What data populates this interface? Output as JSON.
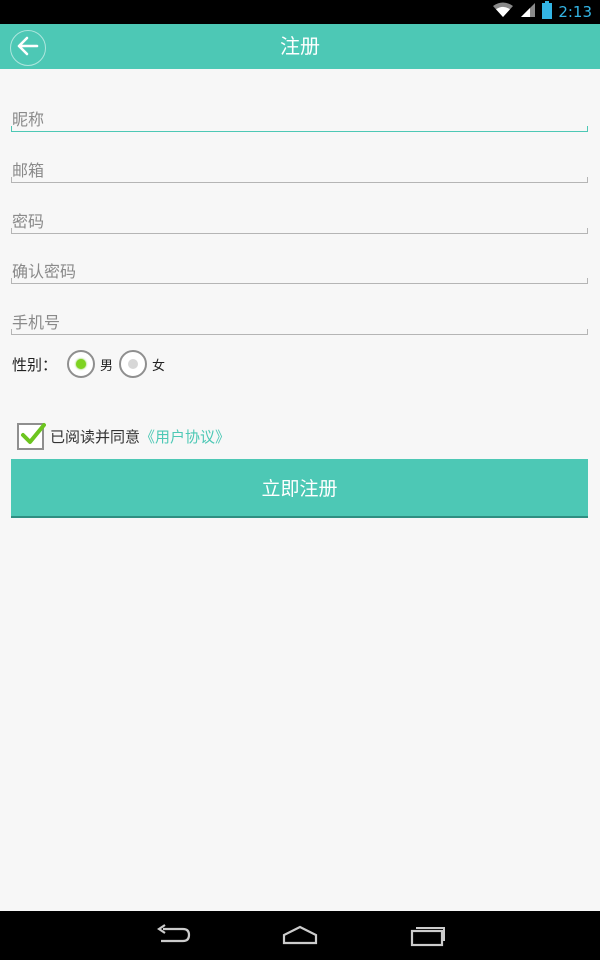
{
  "status": {
    "time": "2:13",
    "icons": [
      "wifi-icon",
      "signal-icon",
      "battery-icon"
    ]
  },
  "header": {
    "title": "注册",
    "back_icon": "arrow-left-icon"
  },
  "form": {
    "nickname_placeholder": "昵称",
    "email_placeholder": "邮箱",
    "password_placeholder": "密码",
    "confirm_password_placeholder": "确认密码",
    "phone_placeholder": "手机号"
  },
  "gender": {
    "label": "性别：",
    "options": [
      {
        "label": "男",
        "selected": true
      },
      {
        "label": "女",
        "selected": false
      }
    ]
  },
  "agreement": {
    "checked": true,
    "text": "已阅读并同意",
    "link": "《用户协议》"
  },
  "register_button": "立即注册",
  "nav": {
    "icons": [
      "back-icon",
      "home-icon",
      "recents-icon"
    ]
  },
  "colors": {
    "accent": "#4dc8b5",
    "radio_selected": "#7ed321"
  }
}
